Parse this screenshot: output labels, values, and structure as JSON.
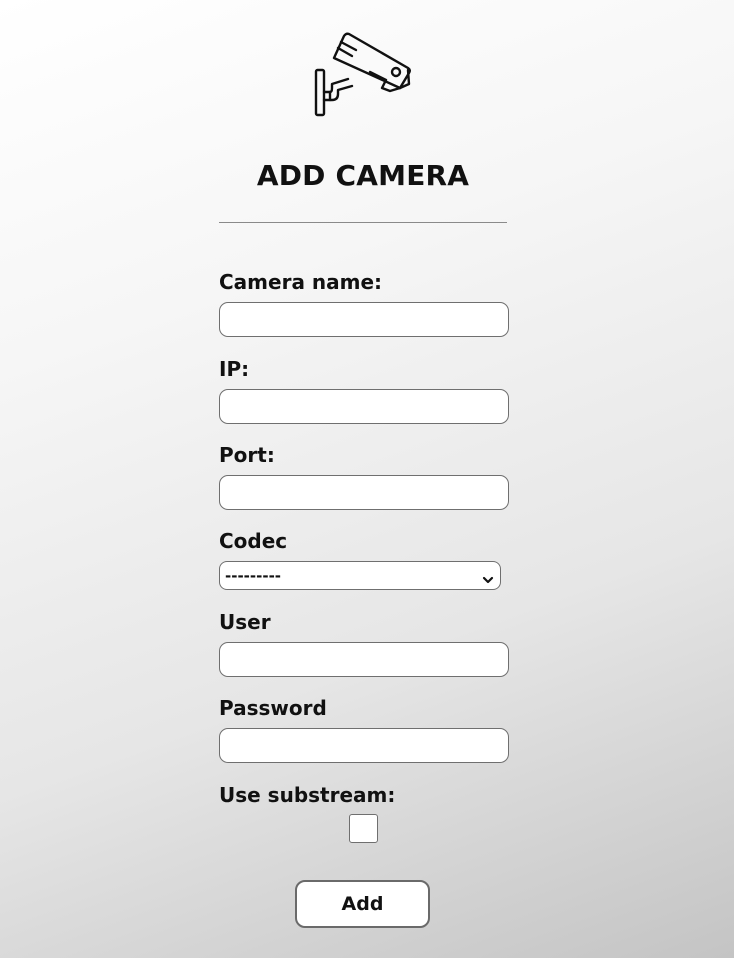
{
  "header": {
    "logo_icon": "security-camera-icon",
    "title": "ADD CAMERA"
  },
  "form": {
    "camera_name": {
      "label": "Camera name:",
      "value": "",
      "placeholder": ""
    },
    "ip": {
      "label": "IP:",
      "value": "",
      "placeholder": ""
    },
    "port": {
      "label": "Port:",
      "value": "",
      "placeholder": ""
    },
    "codec": {
      "label": "Codec",
      "selected": "---------",
      "icon": "chevron-down-icon"
    },
    "user": {
      "label": "User",
      "value": "",
      "placeholder": ""
    },
    "password": {
      "label": "Password",
      "value": "",
      "placeholder": ""
    },
    "use_substream": {
      "label": "Use substream:",
      "checked": false
    },
    "submit_label": "Add"
  }
}
